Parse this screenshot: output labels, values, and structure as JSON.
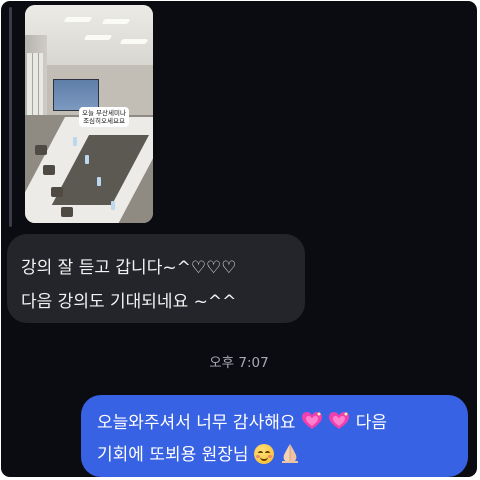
{
  "conversation": {
    "photo": {
      "sticker_line1": "오늘 부산세미나",
      "sticker_line2": "조심히오세요요"
    },
    "incoming": {
      "line1": "강의 잘 듣고 갑니다~^♡♡♡",
      "line2": "다음 강의도 기대되네요 ~^^"
    },
    "timestamp": "오후 7:07",
    "outgoing": {
      "line1_text": "오늘와주셔서 너무 감사해요",
      "line1_after": "다음",
      "line2_text": "기회에 또뵈용 원장님"
    }
  },
  "icons": {
    "line1": [
      "sparkling-heart-emoji",
      "sparkling-heart-emoji"
    ],
    "line2": [
      "smiling-face-emoji",
      "folded-hands-emoji"
    ]
  },
  "colors": {
    "background": "#0b0c12",
    "incoming_bubble": "#24252b",
    "outgoing_bubble": "#3862e4",
    "timestamp": "#a8a9b0"
  }
}
